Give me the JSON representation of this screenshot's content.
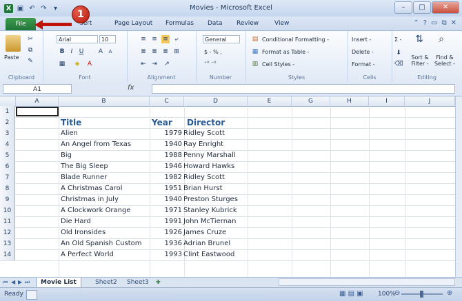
{
  "window": {
    "title": "Movies - Microsoft Excel",
    "controls": [
      "–",
      "□",
      "✕"
    ]
  },
  "callout": {
    "number": "1"
  },
  "tabs": {
    "file": "File",
    "items": [
      "sert",
      "Page Layout",
      "Formulas",
      "Data",
      "Review",
      "View"
    ]
  },
  "ribbon": {
    "clipboard": {
      "label": "Clipboard",
      "paste": "Paste"
    },
    "font": {
      "label": "Font",
      "name": "Arial",
      "size": "10"
    },
    "alignment": {
      "label": "Alignment"
    },
    "number": {
      "label": "Number",
      "format": "General",
      "symbols": "$ - % ,"
    },
    "styles": {
      "label": "Styles",
      "conditional": "Conditional Formatting -",
      "table": "Format as Table -",
      "cell": "Cell Styles -"
    },
    "cells": {
      "label": "Cells",
      "insert": "Insert -",
      "delete": "Delete -",
      "format": "Format -"
    },
    "editing": {
      "label": "Editing",
      "sort": "Sort & Filter -",
      "find": "Find & Select -",
      "sigma": "Σ -"
    }
  },
  "formula_bar": {
    "name_box": "A1",
    "fx": "fx",
    "value": ""
  },
  "columns": [
    "A",
    "B",
    "C",
    "D",
    "E",
    "G",
    "H",
    "I",
    "J"
  ],
  "rows": [
    {
      "n": "1",
      "title": "",
      "year": "",
      "director": ""
    },
    {
      "n": "2",
      "title": "Title",
      "year": "Year",
      "director": "Director"
    },
    {
      "n": "3",
      "title": "Alien",
      "year": "1979",
      "director": "Ridley Scott"
    },
    {
      "n": "4",
      "title": "An Angel from Texas",
      "year": "1940",
      "director": "Ray Enright"
    },
    {
      "n": "5",
      "title": "Big",
      "year": "1988",
      "director": "Penny Marshall"
    },
    {
      "n": "6",
      "title": "The Big Sleep",
      "year": "1946",
      "director": "Howard Hawks"
    },
    {
      "n": "7",
      "title": "Blade Runner",
      "year": "1982",
      "director": "Ridley Scott"
    },
    {
      "n": "8",
      "title": "A Christmas Carol",
      "year": "1951",
      "director": "Brian Hurst"
    },
    {
      "n": "9",
      "title": "Christmas in July",
      "year": "1940",
      "director": "Preston Sturges"
    },
    {
      "n": "10",
      "title": "A Clockwork Orange",
      "year": "1971",
      "director": "Stanley Kubrick"
    },
    {
      "n": "11",
      "title": "Die Hard",
      "year": "1991",
      "director": "John McTiernan"
    },
    {
      "n": "12",
      "title": "Old Ironsides",
      "year": "1926",
      "director": "James Cruze"
    },
    {
      "n": "13",
      "title": "An Old Spanish Custom",
      "year": "1936",
      "director": "Adrian Brunel"
    },
    {
      "n": "14",
      "title": "A Perfect World",
      "year": "1993",
      "director": "Clint Eastwood"
    }
  ],
  "sheets": [
    "Movie List",
    "Sheet2",
    "Sheet3"
  ],
  "status": {
    "ready": "Ready",
    "zoom": "100%"
  },
  "colors": {
    "file_tab": "#21763a",
    "header_text": "#2a5a96",
    "callout": "#c0150a"
  }
}
